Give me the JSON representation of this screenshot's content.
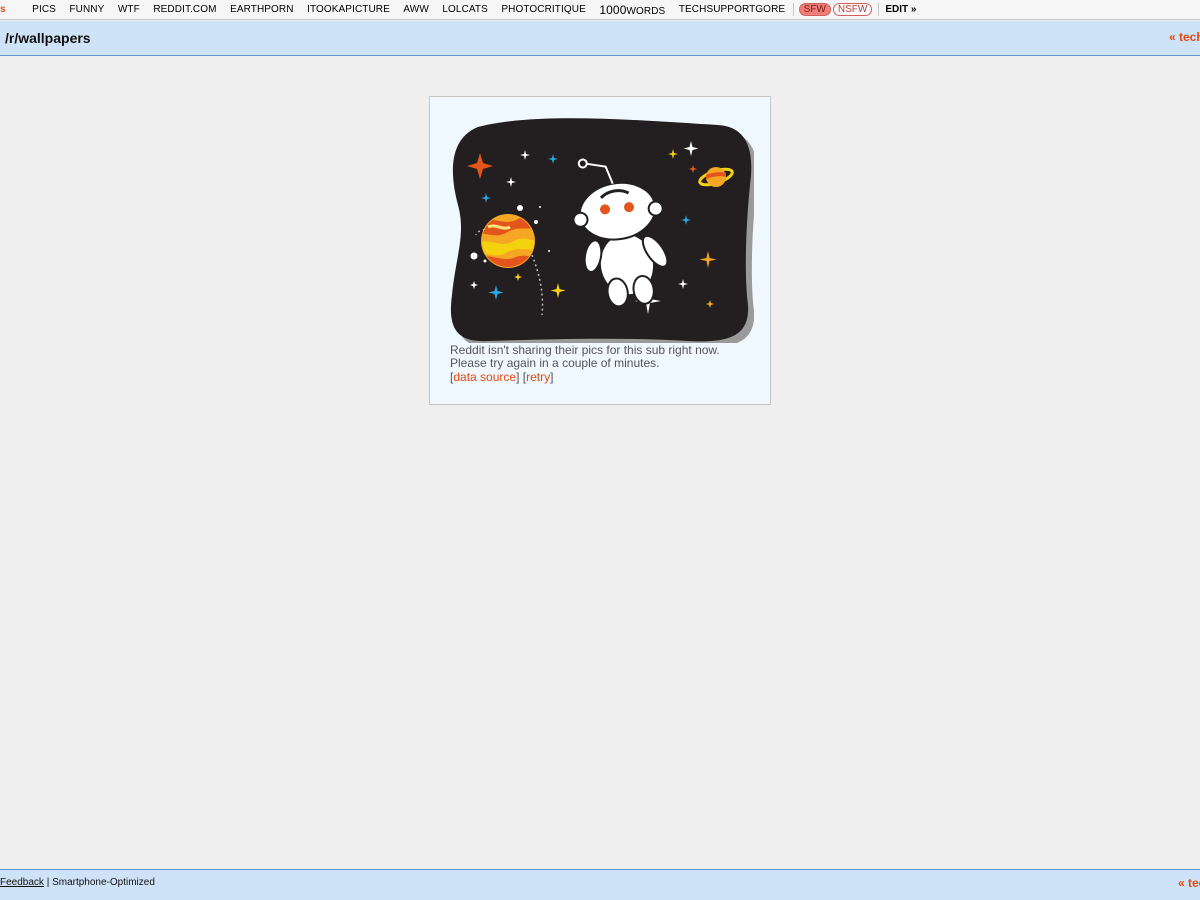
{
  "topbar": {
    "first": "s",
    "subs": [
      "PICS",
      "FUNNY",
      "WTF",
      "REDDIT.COM",
      "EARTHPORN",
      "ITOOKAPICTURE",
      "AWW",
      "LOLCATS",
      "PHOTOCRITIQUE"
    ],
    "words_num": "1000",
    "words_suffix": "WORDS",
    "last_sub": "TECHSUPPORTGORE",
    "sfw": "SFW",
    "nsfw": "NSFW",
    "edit": "EDIT »"
  },
  "header": {
    "title": "/r/wallpapers",
    "nav_right": "« tech"
  },
  "notice": {
    "line1": "Reddit isn't sharing their pics for this sub right now.",
    "line2": "Please try again in a couple of minutes.",
    "data_source": "data source",
    "retry": "retry"
  },
  "footer": {
    "feedback": "Feedback",
    "sep": " | ",
    "mode": "Smartphone-Optimized",
    "nav_right": "« tech"
  },
  "colors": {
    "accent": "#e04a10",
    "header_bg": "#cee3f8",
    "page_bg": "#efefef",
    "card_bg": "#eff7ff"
  }
}
